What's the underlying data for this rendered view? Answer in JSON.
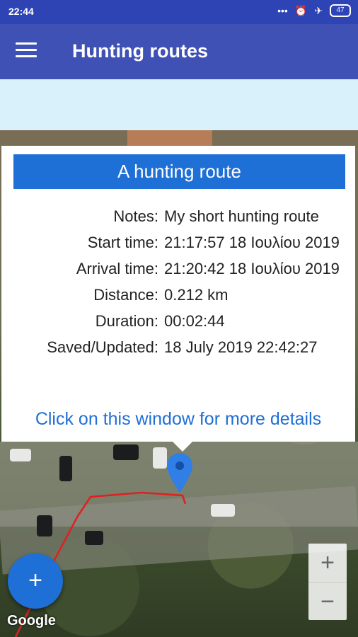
{
  "status_bar": {
    "time": "22:44",
    "battery": "47"
  },
  "appbar": {
    "title": "Hunting routes"
  },
  "info_window": {
    "title": "A hunting route",
    "rows": [
      {
        "label": "Notes:",
        "value": "My short hunting route"
      },
      {
        "label": "Start time:",
        "value": "21:17:57 18 Ιουλίου 2019"
      },
      {
        "label": "Arrival time:",
        "value": "21:20:42 18 Ιουλίου 2019"
      },
      {
        "label": "Distance:",
        "value": "0.212  km"
      },
      {
        "label": "Duration:",
        "value": "00:02:44"
      },
      {
        "label": "Saved/Updated:",
        "value": "18 July 2019 22:42:27"
      }
    ],
    "more_link": "Click on this window for more details"
  },
  "map": {
    "fab_label": "+",
    "zoom_in": "+",
    "zoom_out": "−",
    "attribution": "Google",
    "route_color": "#e02020",
    "marker_color": "#2f7fe6"
  },
  "colors": {
    "status_bar": "#2f44b4",
    "appbar": "#3f51b5",
    "accent": "#1e6fd6"
  }
}
